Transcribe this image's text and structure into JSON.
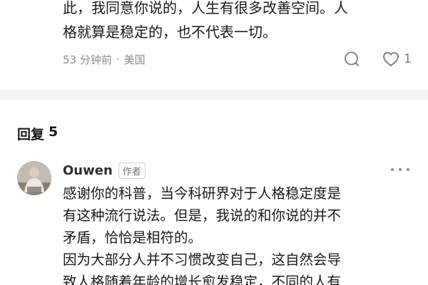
{
  "top_comment": {
    "text_lines": [
      "此，我同意你说的，人生有很多改善空间。人",
      "格就算是稳定的，也不代表一切。"
    ],
    "time": "53 分钟前",
    "separator": "·",
    "location": "美国",
    "like_count": "1",
    "icons": {
      "comment": "comment-bubble-icon",
      "like": "heart-icon"
    }
  },
  "replies": {
    "label": "回复",
    "count": "5"
  },
  "reply": {
    "author": "Ouwen",
    "badge": "作者",
    "icons": {
      "more": "more-dots-icon",
      "avatar": "avatar-image"
    },
    "body_lines": [
      "感谢你的科普，当今科研界对于人格稳定度是",
      "有这种流行说法。但是，我说的和你说的并不",
      "矛盾，恰恰是相符的。",
      "因为大部分人并不习惯改变自己，这自然会导",
      "致人格随着年龄的增长愈发稳定，不同的人有"
    ]
  }
}
